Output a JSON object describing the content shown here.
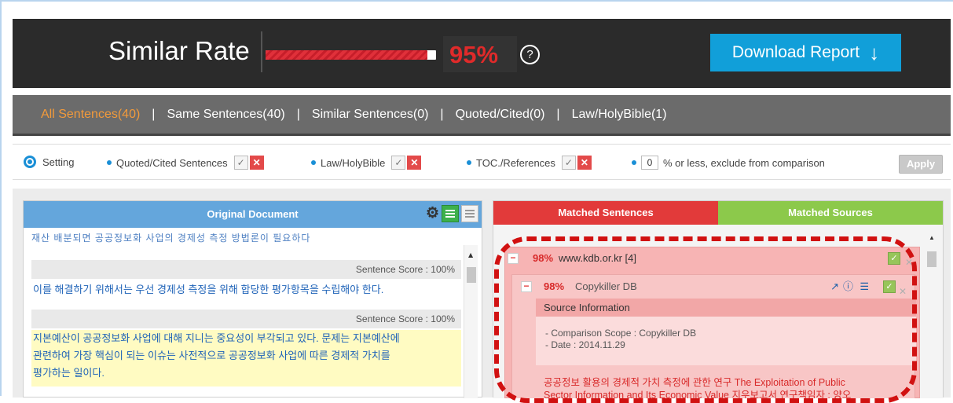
{
  "header": {
    "title": "Similar Rate",
    "rate_value": 0.95,
    "rate_text": "95%",
    "help": "?",
    "download_label": "Download Report",
    "download_icon": "↓"
  },
  "tabs": [
    {
      "label": "All Sentences(40)",
      "active": true
    },
    {
      "label": "Same Sentences(40)"
    },
    {
      "label": "Similar Sentences(0)"
    },
    {
      "label": "Quoted/Cited(0)"
    },
    {
      "label": "Law/HolyBible(1)"
    }
  ],
  "settings": {
    "setting_label": "Setting",
    "quoted": "Quoted/Cited Sentences",
    "law": "Law/HolyBible",
    "toc": "TOC./References",
    "threshold_value": "0",
    "threshold_text": "% or less, exclude from comparison",
    "apply": "Apply",
    "check": "✓",
    "cross": "✕"
  },
  "left_panel": {
    "title": "Original Document",
    "cut_line": "재산 배분되면 공공정보화 사업의 경제성 측정 방법론이 필요하다",
    "scores": [
      "Sentence Score : 100%",
      "Sentence Score : 100%"
    ],
    "sentence1": "이를 해결하기 위해서는 우선 경제성 측정을 위해 합당한 평가항목을 수립해야 한다.",
    "sentence2_line1": "지본예산이 공공정보화 사업에 대해 지니는 중요성이 부각되고 있다. 문제는 지본예산에",
    "sentence2_line2": "관련하여 가장 핵심이 되는 이슈는 사전적으로 공공정보화 사업에 따른 경제적 가치를",
    "sentence2_line3": "평가하는 일이다."
  },
  "right_panel": {
    "tab_matched_sentences": "Matched Sentences",
    "tab_matched_sources": "Matched Sources",
    "group": {
      "pct": "98%",
      "site": "www.kdb.or.kr [4]",
      "minus": "−"
    },
    "source": {
      "pct": "98%",
      "name": "Copykiller DB",
      "info_title": "Source Information",
      "scope": "- Comparison Scope : Copykiller DB",
      "date": "- Date : 2014.11.29",
      "result_line1": "공공정보 활용의 경제적 가치 측정에 관한 연구 The Exploitation of Public",
      "result_line2": "Sector Information and Its Economic Value 지우보고서 연구책임자 : 양오"
    }
  }
}
